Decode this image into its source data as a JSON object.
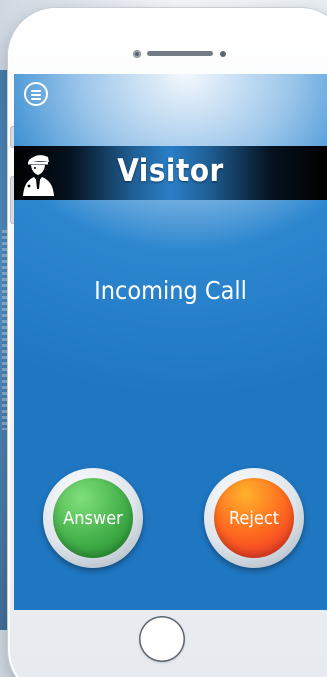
{
  "screen": {
    "title": "Visitor",
    "status_text": "Incoming Call"
  },
  "actions": {
    "answer_label": "Answer",
    "reject_label": "Reject"
  },
  "icons": {
    "menu": "menu-icon",
    "visitor": "visitor-guard-icon",
    "home": "home-button"
  },
  "colors": {
    "screen_blue": "#1f77c2",
    "answer_green": "#44b04a",
    "reject_orange": "#ff6a1f",
    "reject_red": "#e8262a",
    "header_black": "#000000"
  }
}
